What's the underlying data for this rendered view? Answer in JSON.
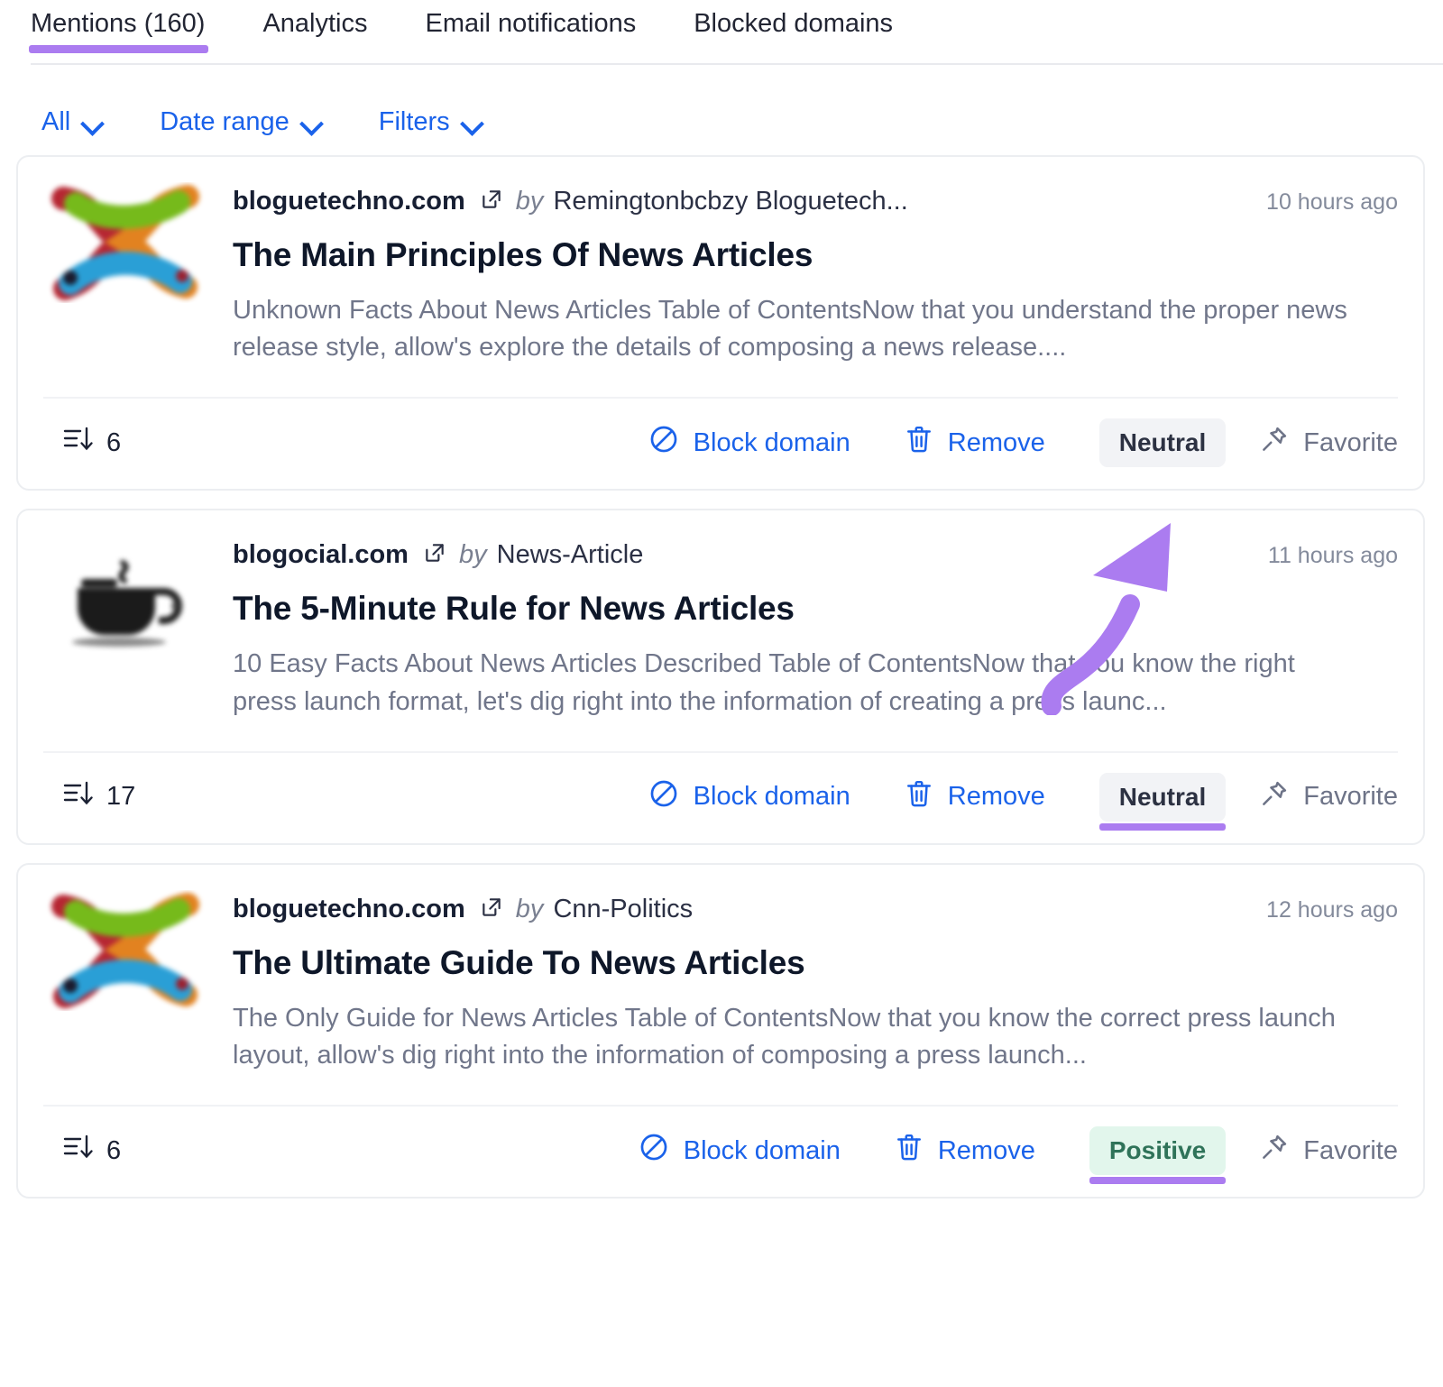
{
  "tabs": [
    {
      "label": "Mentions (160)",
      "active": true
    },
    {
      "label": "Analytics",
      "active": false
    },
    {
      "label": "Email notifications",
      "active": false
    },
    {
      "label": "Blocked domains",
      "active": false
    }
  ],
  "filters": [
    {
      "label": "All"
    },
    {
      "label": "Date range"
    },
    {
      "label": "Filters"
    }
  ],
  "colors": {
    "accent_purple": "#ab7cf0",
    "link_blue": "#1a62ea",
    "neutral_badge_bg": "#f2f3f6",
    "positive_badge_bg": "#e2f6ec",
    "positive_badge_text": "#2f7359"
  },
  "actions": {
    "block_domain": "Block domain",
    "remove": "Remove",
    "favorite": "Favorite",
    "by": "by"
  },
  "mentions": [
    {
      "domain": "bloguetechno.com",
      "author": "Remingtonbcbzy Bloguetech...",
      "time": "10 hours ago",
      "title": "The Main Principles Of News Articles",
      "snippet": "Unknown Facts About News Articles Table of ContentsNow that you understand the proper news release style, allow's explore the details of composing a news release....",
      "backlinks": "6",
      "sentiment": "Neutral",
      "sentiment_type": "neutral",
      "sentiment_underlined": false,
      "thumb": "colorful-x-logo"
    },
    {
      "domain": "blogocial.com",
      "author": "News-Article",
      "time": "11 hours ago",
      "title": "The 5-Minute Rule for News Articles",
      "snippet": "10 Easy Facts About News Articles Described Table of ContentsNow that you know the right press launch format, let's dig right into the information of creating a press launc...",
      "backlinks": "17",
      "sentiment": "Neutral",
      "sentiment_type": "neutral",
      "sentiment_underlined": true,
      "thumb": "coffee-cup"
    },
    {
      "domain": "bloguetechno.com",
      "author": "Cnn-Politics",
      "time": "12 hours ago",
      "title": "The Ultimate Guide To News Articles",
      "snippet": "The Only Guide for News Articles Table of ContentsNow that you know the correct press launch layout, allow's dig right into the information of composing a press launch...",
      "backlinks": "6",
      "sentiment": "Positive",
      "sentiment_type": "positive",
      "sentiment_underlined": true,
      "thumb": "colorful-x-logo"
    }
  ]
}
